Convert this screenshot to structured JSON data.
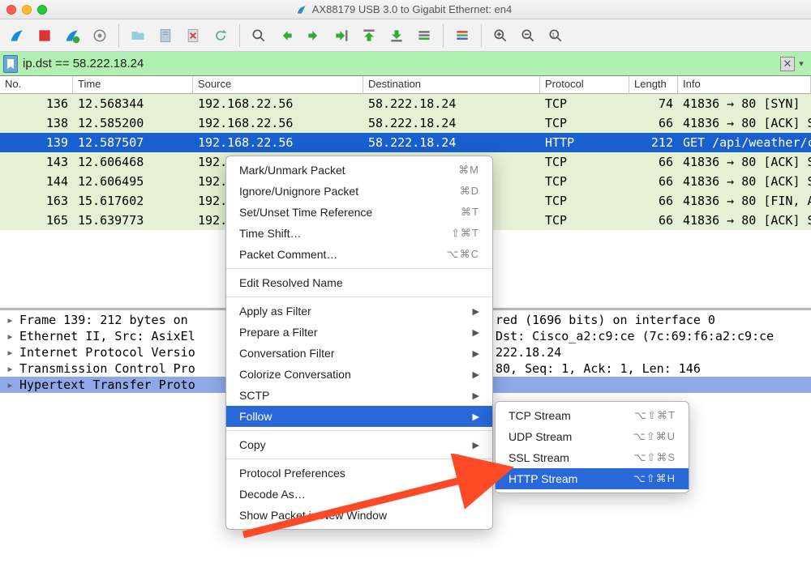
{
  "title": "AX88179 USB 3.0 to Gigabit Ethernet: en4",
  "filter": {
    "value": "ip.dst == 58.222.18.24"
  },
  "columns": {
    "no": "No.",
    "time": "Time",
    "src": "Source",
    "dst": "Destination",
    "proto": "Protocol",
    "len": "Length",
    "info": "Info"
  },
  "packets": [
    {
      "no": "136",
      "time": "12.568344",
      "src": "192.168.22.56",
      "dst": "58.222.18.24",
      "proto": "TCP",
      "len": "74",
      "info": "41836 → 80 [SYN]"
    },
    {
      "no": "138",
      "time": "12.585200",
      "src": "192.168.22.56",
      "dst": "58.222.18.24",
      "proto": "TCP",
      "len": "66",
      "info": "41836 → 80 [ACK] S"
    },
    {
      "no": "139",
      "time": "12.587507",
      "src": "192.168.22.56",
      "dst": "58.222.18.24",
      "proto": "HTTP",
      "len": "212",
      "info": "GET /api/weather/c",
      "selected": true
    },
    {
      "no": "143",
      "time": "12.606468",
      "src": "192.",
      "dst": "",
      "proto": "TCP",
      "len": "66",
      "info": "41836 → 80 [ACK] S"
    },
    {
      "no": "144",
      "time": "12.606495",
      "src": "192.",
      "dst": "",
      "proto": "TCP",
      "len": "66",
      "info": "41836 → 80 [ACK] S"
    },
    {
      "no": "163",
      "time": "15.617602",
      "src": "192.",
      "dst": "",
      "proto": "TCP",
      "len": "66",
      "info": "41836 → 80 [FIN, A"
    },
    {
      "no": "165",
      "time": "15.639773",
      "src": "192.",
      "dst": "",
      "proto": "TCP",
      "len": "66",
      "info": "41836 → 80 [ACK] S"
    }
  ],
  "details": [
    {
      "t": "Frame 139: 212 bytes on",
      "r": "red (1696 bits) on interface 0"
    },
    {
      "t": "Ethernet II, Src: AsixEl",
      "r": "Dst: Cisco_a2:c9:ce (7c:69:f6:a2:c9:ce"
    },
    {
      "t": "Internet Protocol Versio",
      "r": "222.18.24"
    },
    {
      "t": "Transmission Control Pro",
      "r": "80, Seq: 1, Ack: 1, Len: 146"
    },
    {
      "t": "Hypertext Transfer Proto",
      "r": "",
      "selected": true
    }
  ],
  "menu": {
    "groups": [
      [
        {
          "label": "Mark/Unmark Packet",
          "sc": "⌘M"
        },
        {
          "label": "Ignore/Unignore Packet",
          "sc": "⌘D"
        },
        {
          "label": "Set/Unset Time Reference",
          "sc": "⌘T"
        },
        {
          "label": "Time Shift…",
          "sc": "⇧⌘T"
        },
        {
          "label": "Packet Comment…",
          "sc": "⌥⌘C"
        }
      ],
      [
        {
          "label": "Edit Resolved Name"
        }
      ],
      [
        {
          "label": "Apply as Filter",
          "sub": true
        },
        {
          "label": "Prepare a Filter",
          "sub": true
        },
        {
          "label": "Conversation Filter",
          "sub": true
        },
        {
          "label": "Colorize Conversation",
          "sub": true
        },
        {
          "label": "SCTP",
          "sub": true
        },
        {
          "label": "Follow",
          "sub": true,
          "selected": true
        }
      ],
      [
        {
          "label": "Copy",
          "sub": true
        }
      ],
      [
        {
          "label": "Protocol Preferences",
          "sub": true
        },
        {
          "label": "Decode As…"
        },
        {
          "label": "Show Packet in New Window"
        }
      ]
    ],
    "follow_sub": [
      {
        "label": "TCP Stream",
        "sc": "⌥⇧⌘T"
      },
      {
        "label": "UDP Stream",
        "sc": "⌥⇧⌘U"
      },
      {
        "label": "SSL Stream",
        "sc": "⌥⇧⌘S"
      },
      {
        "label": "HTTP Stream",
        "sc": "⌥⇧⌘H",
        "selected": true
      }
    ]
  }
}
